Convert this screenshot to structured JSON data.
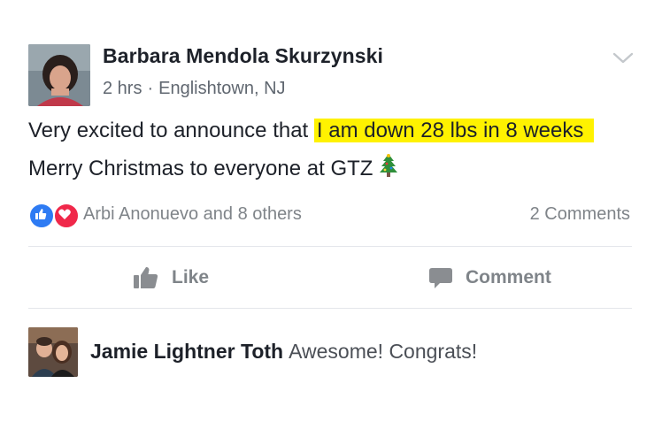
{
  "post": {
    "author": "Barbara Mendola Skurzynski",
    "time": "2 hrs",
    "separator": "·",
    "location": "Englishtown, NJ",
    "text_prefix": "Very excited to announce that ",
    "text_highlight": "I am down 28 lbs in 8 weeks",
    "text_line2": "Merry Christmas to everyone at GTZ",
    "emoji": "christmas-tree-icon",
    "highlight_color": "#fff200"
  },
  "reactions": {
    "icons": [
      "like-reaction-icon",
      "love-reaction-icon"
    ],
    "like_color": "#2e7bf3",
    "love_color": "#f0284a",
    "summary": "Arbi Anonuevo and 8 others",
    "comments_count": "2 Comments"
  },
  "actions": {
    "like_label": "Like",
    "comment_label": "Comment"
  },
  "comment": {
    "author": "Jamie Lightner Toth",
    "text": "Awesome! Congrats!"
  }
}
